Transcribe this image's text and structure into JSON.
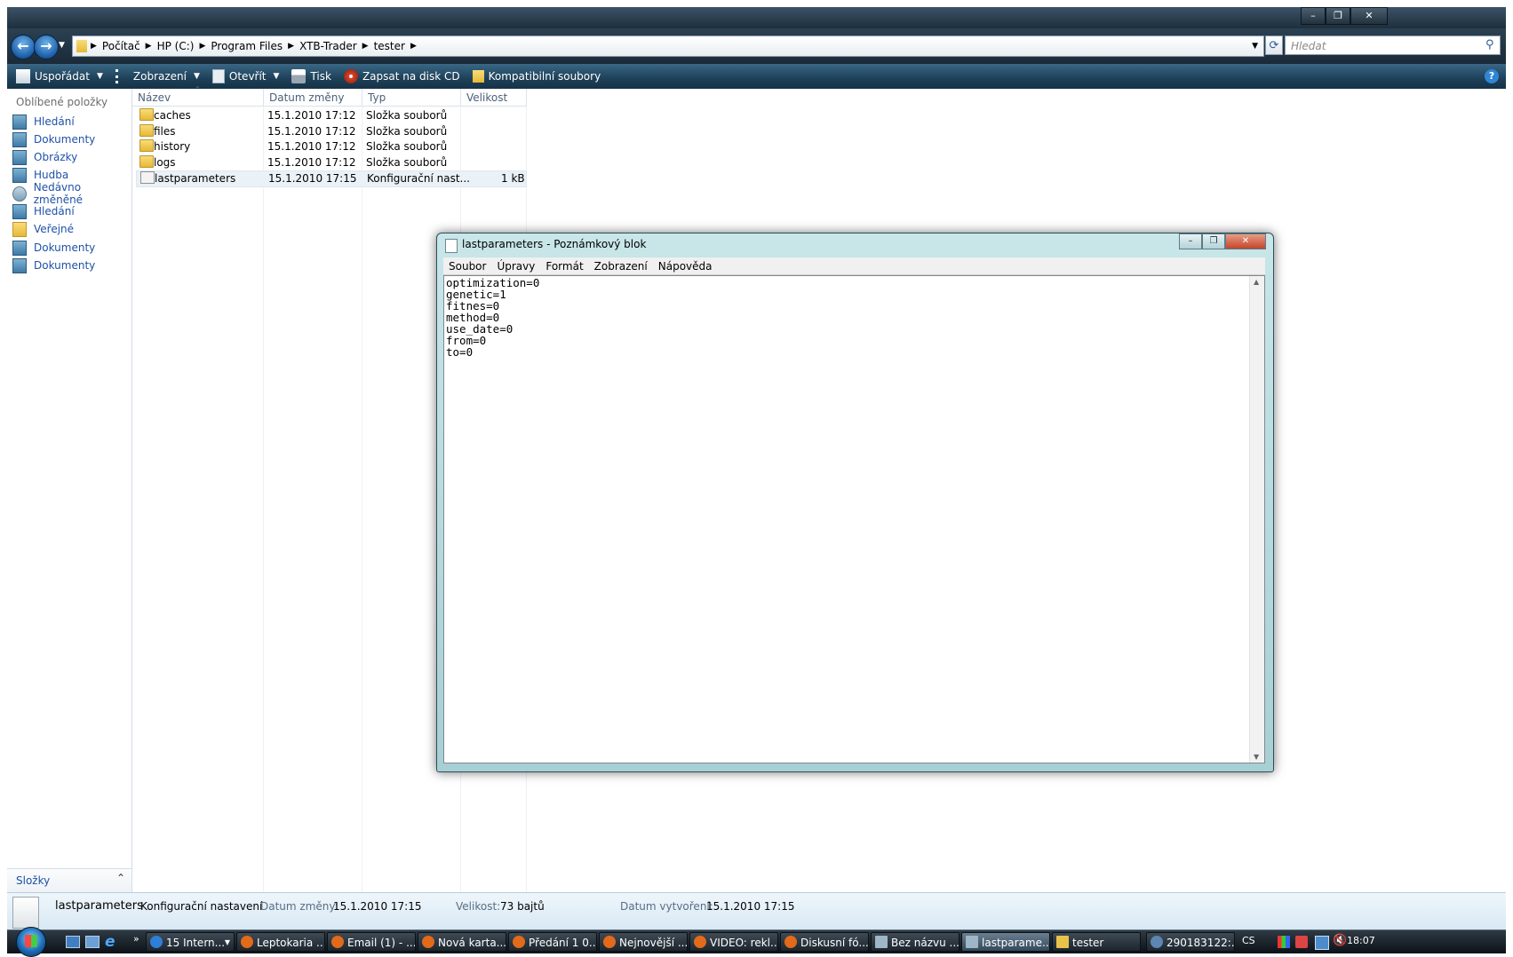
{
  "explorer": {
    "breadcrumb": [
      "Počítač",
      "HP (C:)",
      "Program Files",
      "XTB-Trader",
      "tester"
    ],
    "search_placeholder": "Hledat",
    "toolbar": {
      "organize": "Uspořádat",
      "views": "Zobrazení",
      "open": "Otevřít",
      "print": "Tisk",
      "burn": "Zapsat na disk CD",
      "compat": "Kompatibilní soubory"
    },
    "nav": {
      "header": "Oblíbené položky",
      "items": [
        "Hledání",
        "Dokumenty",
        "Obrázky",
        "Hudba",
        "Nedávno změněné",
        "Hledání",
        "Veřejné",
        "Dokumenty",
        "Dokumenty"
      ],
      "folders_label": "Složky"
    },
    "columns": [
      "Název",
      "Datum změny",
      "Typ",
      "Velikost"
    ],
    "files": [
      {
        "name": "caches",
        "date": "15.1.2010 17:12",
        "type": "Složka souborů",
        "size": ""
      },
      {
        "name": "files",
        "date": "15.1.2010 17:12",
        "type": "Složka souborů",
        "size": ""
      },
      {
        "name": "history",
        "date": "15.1.2010 17:12",
        "type": "Složka souborů",
        "size": ""
      },
      {
        "name": "logs",
        "date": "15.1.2010 17:12",
        "type": "Složka souborů",
        "size": ""
      },
      {
        "name": "lastparameters",
        "date": "15.1.2010 17:15",
        "type": "Konfigurační nast...",
        "size": "1 kB"
      }
    ],
    "details": {
      "name": "lastparameters",
      "type": "Konfigurační nastavení",
      "modified_label": "Datum změny:",
      "modified": "15.1.2010 17:15",
      "size_label": "Velikost:",
      "size": "73 bajtů",
      "created_label": "Datum vytvoření:",
      "created": "15.1.2010 17:15"
    }
  },
  "notepad": {
    "title": "lastparameters - Poznámkový blok",
    "menu": [
      "Soubor",
      "Úpravy",
      "Formát",
      "Zobrazení",
      "Nápověda"
    ],
    "content": "optimization=0\ngenetic=1\nfitnes=0\nmethod=0\nuse_date=0\nfrom=0\nto=0"
  },
  "taskbar": {
    "buttons": [
      {
        "label": "15 Intern...",
        "color": "#2e7fd6"
      },
      {
        "label": "Leptokaria ...",
        "color": "#e26a1a"
      },
      {
        "label": "Email (1) - ...",
        "color": "#e26a1a"
      },
      {
        "label": "Nová karta...",
        "color": "#e26a1a"
      },
      {
        "label": "Předání 1 0...",
        "color": "#e26a1a"
      },
      {
        "label": "Nejnovější ...",
        "color": "#e26a1a"
      },
      {
        "label": "VIDEO: rekl...",
        "color": "#e26a1a"
      },
      {
        "label": "Diskusní fó...",
        "color": "#e26a1a"
      },
      {
        "label": "Bez názvu ...",
        "color": "#9fb6c6"
      },
      {
        "label": "lastparame...",
        "color": "#9fb6c6"
      },
      {
        "label": "tester",
        "color": "#e8c24a"
      },
      {
        "label": "290183122:...",
        "color": "#5d86b0"
      }
    ],
    "lang": "CS",
    "time": "18:07"
  }
}
